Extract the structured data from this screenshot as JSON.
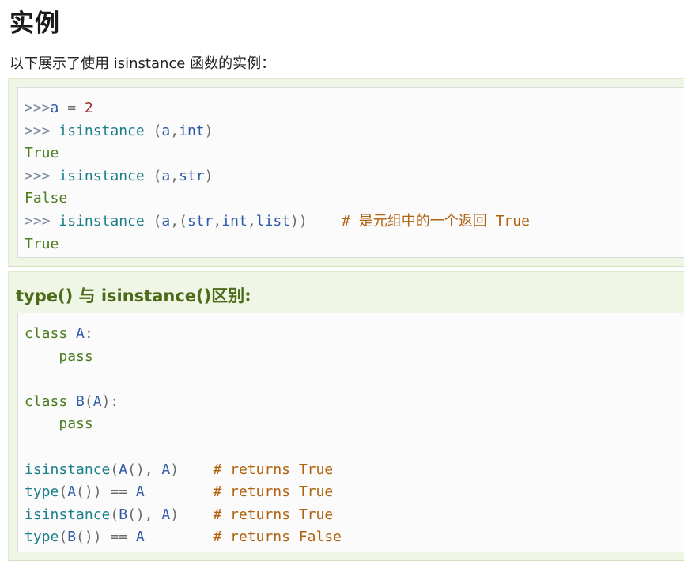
{
  "heading": "实例",
  "intro": "以下展示了使用 isinstance 函数的实例：",
  "example1": {
    "lines": [
      [
        ">>>",
        "a",
        " = ",
        "2"
      ],
      [
        ">>> ",
        "isinstance",
        " (",
        "a",
        ",",
        "int",
        ")"
      ],
      [
        "True"
      ],
      [
        ">>> ",
        "isinstance",
        " (",
        "a",
        ",",
        "str",
        ")"
      ],
      [
        "False"
      ],
      [
        ">>> ",
        "isinstance",
        " (",
        "a",
        ",(",
        "str",
        ",",
        "int",
        ",",
        "list",
        "))",
        "    # 是元组中的一个返回 True"
      ],
      [
        "True"
      ]
    ]
  },
  "section2": {
    "title": "type() 与 isinstance()区别:"
  },
  "example2": {
    "lines": [
      [
        "class",
        " A",
        ":"
      ],
      [
        "    ",
        "pass"
      ],
      [
        ""
      ],
      [
        "class",
        " B",
        "(",
        "A",
        "):"
      ],
      [
        "    ",
        "pass"
      ],
      [
        ""
      ],
      [
        "isinstance",
        "(",
        "A",
        "(), ",
        "A",
        ")",
        "    # returns True"
      ],
      [
        "type",
        "(",
        "A",
        "()) == ",
        "A",
        "        # returns True"
      ],
      [
        "isinstance",
        "(",
        "B",
        "(), ",
        "A",
        ")",
        "    # returns True"
      ],
      [
        "type",
        "(",
        "B",
        "()) == ",
        "A",
        "        # returns False"
      ]
    ]
  }
}
